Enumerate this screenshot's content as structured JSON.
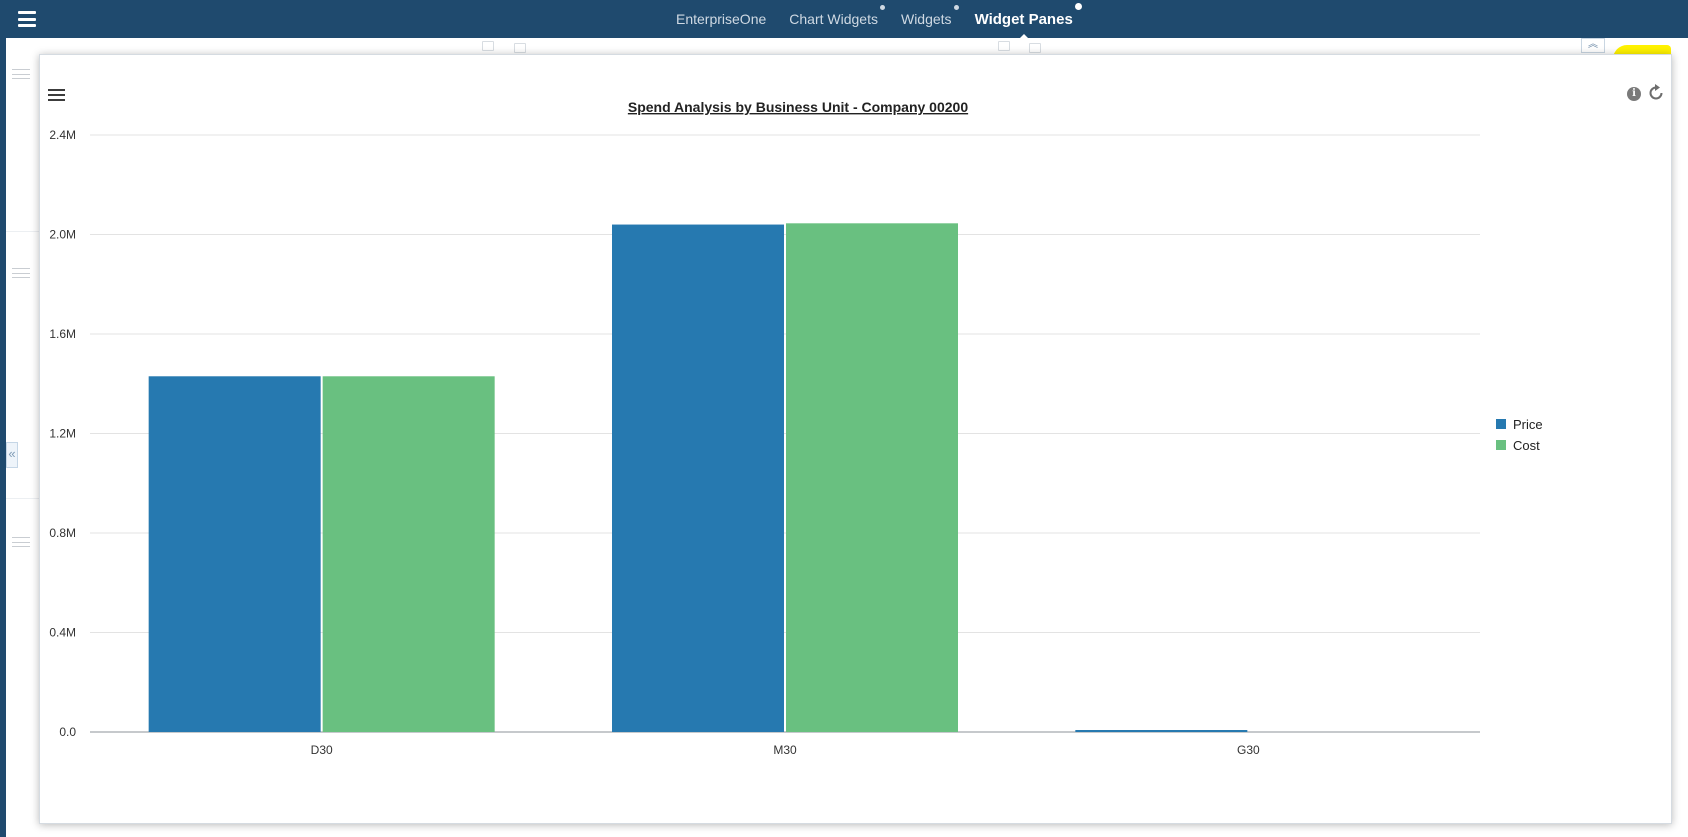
{
  "nav": {
    "tabs": [
      {
        "label": "EnterpriseOne",
        "dot": false,
        "active": false
      },
      {
        "label": "Chart Widgets",
        "dot": true,
        "active": false
      },
      {
        "label": "Widgets",
        "dot": true,
        "active": false
      },
      {
        "label": "Widget Panes",
        "dot": true,
        "active": true
      }
    ]
  },
  "icons": {
    "app_menu": "hamburger-menu-icon",
    "panel_menu": "hamburger-menu-icon",
    "info": "info-icon",
    "info_glyph": "i",
    "refresh": "refresh-icon",
    "expand": "expand-chevron-icon",
    "collapse_up": "double-chevron-up-icon",
    "collapse_left": "double-chevron-left-icon",
    "collapse_up_glyph": "︽",
    "collapse_left_glyph": "«"
  },
  "colors": {
    "header": "#1f4a6e",
    "highlight": "#fff200",
    "price": "#2679b0",
    "cost": "#69c080"
  },
  "chart_data": {
    "type": "bar",
    "title": "Spend Analysis by Business Unit - Company 00200",
    "categories": [
      "D30",
      "M30",
      "G30"
    ],
    "series": [
      {
        "name": "Price",
        "values": [
          1430000,
          2040000,
          8000
        ]
      },
      {
        "name": "Cost",
        "values": [
          1430000,
          2045000,
          0
        ]
      }
    ],
    "y_ticks": [
      {
        "value": 0,
        "label": "0.0"
      },
      {
        "value": 400000,
        "label": "0.4M"
      },
      {
        "value": 800000,
        "label": "0.8M"
      },
      {
        "value": 1200000,
        "label": "1.2M"
      },
      {
        "value": 1600000,
        "label": "1.6M"
      },
      {
        "value": 2000000,
        "label": "2.0M"
      },
      {
        "value": 2400000,
        "label": "2.4M"
      }
    ],
    "ylim": [
      0,
      2400000
    ],
    "grid": true,
    "legend": "right"
  }
}
